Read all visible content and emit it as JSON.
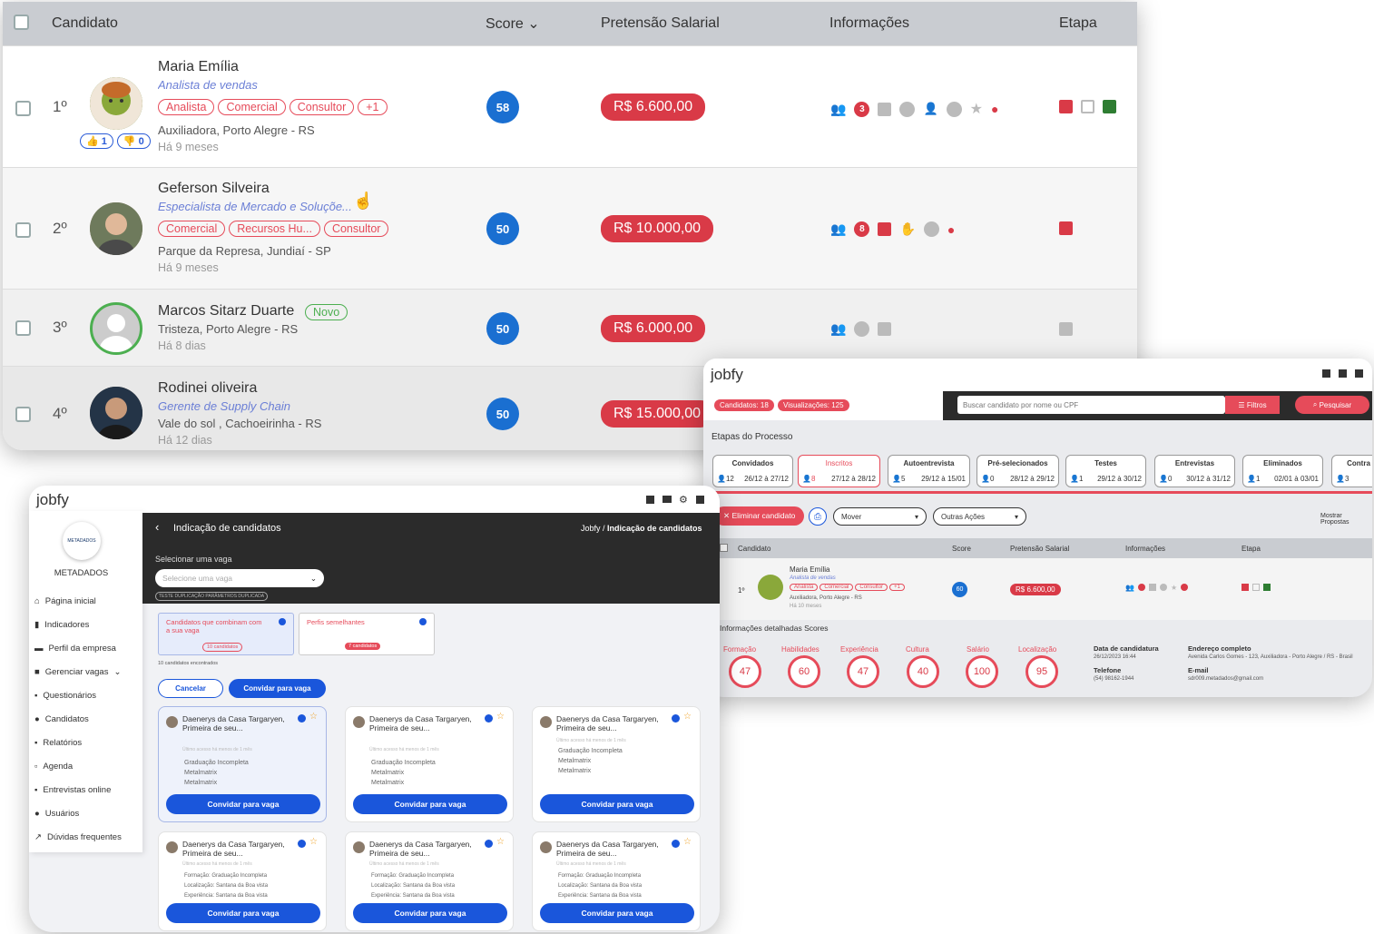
{
  "table": {
    "headers": {
      "candidate": "Candidato",
      "score": "Score",
      "salary": "Pretensão Salarial",
      "info": "Informações",
      "stage": "Etapa"
    },
    "rows": [
      {
        "rank": "1º",
        "name": "Maria Emília",
        "role": "Analista de vendas",
        "tags": [
          "Analista",
          "Comercial",
          "Consultor",
          "+1"
        ],
        "location": "Auxiliadora, Porto Alegre - RS",
        "ago": "Há 9 meses",
        "score": "58",
        "salary": "R$ 6.600,00",
        "likes": "1",
        "dislikes": "0"
      },
      {
        "rank": "2º",
        "name": "Geferson Silveira",
        "role": "Especialista de Mercado e Soluçõe...",
        "tags": [
          "Comercial",
          "Recursos Hu...",
          "Consultor"
        ],
        "location": "Parque da Represa, Jundiaí - SP",
        "ago": "Há 9 meses",
        "score": "50",
        "salary": "R$ 10.000,00"
      },
      {
        "rank": "3º",
        "name": "Marcos Sitarz Duarte",
        "badge": "Novo",
        "location": "Tristeza, Porto Alegre - RS",
        "ago": "Há 8 dias",
        "score": "50",
        "salary": "R$ 6.000,00"
      },
      {
        "rank": "4º",
        "name": "Rodinei oliveira",
        "role": "Gerente de Supply Chain",
        "location": "Vale do sol , Cachoeirinha - RS",
        "ago": "Há 12 dias",
        "score": "50",
        "salary": "R$ 15.000,00"
      }
    ],
    "badge_counts": {
      "row1": "3",
      "row2": "8"
    }
  },
  "process": {
    "logo": "jobfy",
    "chips": [
      "Candidatos: 18",
      "Visualizações: 125"
    ],
    "search_placeholder": "Buscar candidato por nome ou CPF",
    "filters": "Filtros",
    "search": "Pesquisar",
    "title": "Etapas do Processo",
    "stages": [
      {
        "name": "Convidados",
        "count": "12",
        "dates": "26/12 à 27/12"
      },
      {
        "name": "Inscritos",
        "count": "8",
        "dates": "27/12 à 28/12"
      },
      {
        "name": "Autoentrevista",
        "count": "5",
        "dates": "29/12 à 15/01"
      },
      {
        "name": "Pré-selecionados",
        "count": "0",
        "dates": "28/12 à 29/12"
      },
      {
        "name": "Testes",
        "count": "1",
        "dates": "29/12 à 30/12"
      },
      {
        "name": "Entrevistas",
        "count": "0",
        "dates": "30/12 à 31/12"
      },
      {
        "name": "Eliminados",
        "count": "1",
        "dates": "02/01 à 03/01"
      },
      {
        "name": "Contra",
        "count": "3",
        "dates": ""
      }
    ],
    "eliminate": "Eliminar candidato",
    "move": "Mover",
    "other": "Outras Ações",
    "show_proposals": "Mostrar Propostas",
    "headers": {
      "candidate": "Candidato",
      "score": "Score",
      "salary": "Pretensão Salarial",
      "info": "Informações",
      "stage": "Etapa"
    },
    "row": {
      "rank": "1º",
      "name": "Maria Emília",
      "role": "Analista de vendas",
      "tags": [
        "Analista",
        "Comercial",
        "Consultor",
        "+1"
      ],
      "location": "Auxiliadora, Porto Alegre - RS",
      "ago": "Há 10 meses",
      "score": "60",
      "salary": "R$ 6.600,00"
    },
    "scores_title": "Informações detalhadas Scores",
    "scores": [
      {
        "label": "Formação",
        "value": "47"
      },
      {
        "label": "Habilidades",
        "value": "60"
      },
      {
        "label": "Experiência",
        "value": "47"
      },
      {
        "label": "Cultura",
        "value": "40"
      },
      {
        "label": "Salário",
        "value": "100"
      },
      {
        "label": "Localização",
        "value": "95"
      }
    ],
    "apply_label": "Data de candidatura",
    "apply_date": "26/12/2023 16:44",
    "addr_label": "Endereço completo",
    "addr": "Avenida Carlos Gomes - 123, Auxiliadora - Porto Alegre / RS - Brasil",
    "phone_label": "Telefone",
    "phone": "(54) 98162-1944",
    "email_label": "E-mail",
    "email": "sdr009.metadados@gmail.com"
  },
  "referral": {
    "logo": "jobfy",
    "company_logo_text": "METADADOS",
    "company": "METADADOS",
    "menu": [
      "Página inicial",
      "Indicadores",
      "Perfil da empresa",
      "Gerenciar vagas",
      "Questionários",
      "Candidatos",
      "Relatórios",
      "Agenda",
      "Entrevistas online",
      "Usuários",
      "Dúvidas frequentes"
    ],
    "title": "Indicação de candidatos",
    "crumb1": "Jobfy",
    "crumb2": "Indicação de candidatos",
    "select_label": "Selecionar uma vaga",
    "select_placeholder": "Selecione uma vaga",
    "dup_chip": "TESTE DUPLICAÇÃO PARÂMETROS DUPLICADA",
    "match_tab": "Candidatos que combinam com a sua vaga",
    "match_count": "10 candidatos",
    "similar_tab": "Perfis semelhantes",
    "similar_count": "7 candidatos",
    "found": "10 candidatos encontrados",
    "cancel": "Cancelar",
    "invite": "Convidar para vaga",
    "cards_row1": [
      {
        "name": "Daenerys da Casa Targaryen, Primeira de seu...",
        "access": "Último acesso há menos de 1 mês",
        "l1": "Graduação Incompleta",
        "l2": "Metalmatrix",
        "l3": "Metalmatrix"
      },
      {
        "name": "Daenerys da Casa Targaryen, Primeira de seu...",
        "access": "Último acesso há menos de 1 mês",
        "l1": "Graduação Incompleta",
        "l2": "Metalmatrix",
        "l3": "Metalmatrix"
      },
      {
        "name": "Daenerys da Casa Targaryen, Primeira de seu...",
        "access": "Último acesso há menos de 1 mês",
        "l1": "Graduação Incompleta",
        "l2": "Metalmatrix",
        "l3": "Metalmatrix"
      }
    ],
    "cards_row2": [
      {
        "name": "Daenerys da Casa Targaryen, Primeira de seu...",
        "access": "Último acesso há menos de 1 mês",
        "l1": "Formação: Graduação Incompleta",
        "l2": "Localização: Santana da Boa vista",
        "l3": "Experiência: Santana da Boa vista"
      },
      {
        "name": "Daenerys da Casa Targaryen, Primeira de seu...",
        "access": "Último acesso há menos de 1 mês",
        "l1": "Formação: Graduação Incompleta",
        "l2": "Localização: Santana da Boa vista",
        "l3": "Experiência: Santana da Boa vista"
      },
      {
        "name": "Daenerys da Casa Targaryen, Primeira de seu...",
        "access": "Último acesso há menos de 1 mês",
        "l1": "Formação: Graduação Incompleta",
        "l2": "Localização: Santana da Boa vista",
        "l3": "Experiência: Santana da Boa vista"
      }
    ],
    "card_button": "Convidar para vaga"
  },
  "colors": {
    "accent_red": "#d93a47",
    "primary_blue": "#1a56db",
    "header_dark": "#2b2b2b"
  }
}
